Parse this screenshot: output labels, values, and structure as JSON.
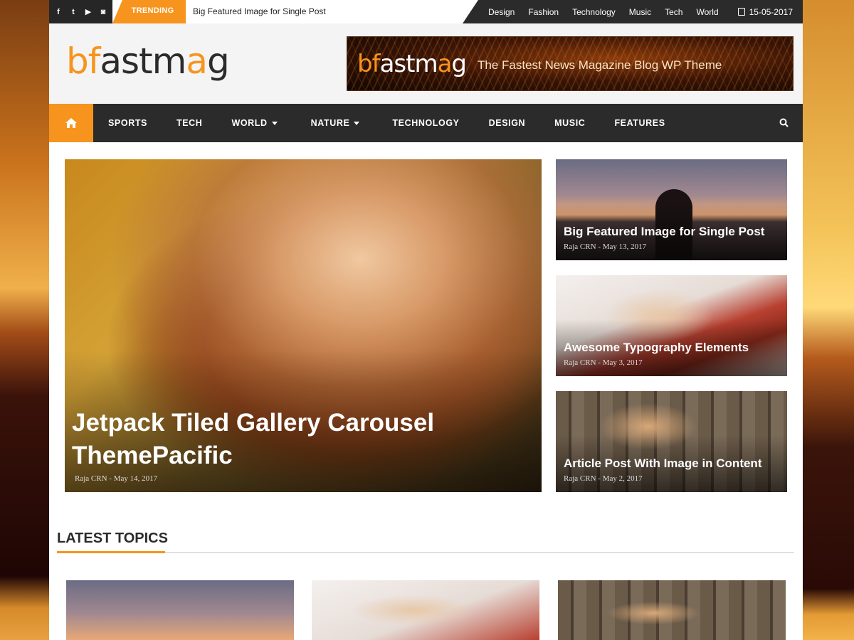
{
  "social": {
    "icons": [
      "facebook-icon",
      "twitter-icon",
      "youtube-icon",
      "instagram-icon"
    ],
    "glyphs": [
      "f",
      "t",
      "▶",
      "◙"
    ]
  },
  "trending": {
    "label": "TRENDING",
    "headline": "Big Featured Image for Single Post"
  },
  "top_nav": {
    "links": [
      "Design",
      "Fashion",
      "Technology",
      "Music",
      "Tech",
      "World"
    ],
    "date": "15-05-2017"
  },
  "logo": {
    "part1": "bf",
    "part2": "a",
    "part3": "stm",
    "part4": "a",
    "part5": "g"
  },
  "banner": {
    "logo_part1": "bf",
    "logo_part2": "a",
    "logo_part3": "stm",
    "logo_part4": "a",
    "logo_part5": "g",
    "tagline": "The Fastest News Magazine Blog WP Theme"
  },
  "main_nav": {
    "items": [
      {
        "label": "SPORTS",
        "dropdown": false
      },
      {
        "label": "TECH",
        "dropdown": false
      },
      {
        "label": "WORLD",
        "dropdown": true
      },
      {
        "label": "NATURE",
        "dropdown": true
      },
      {
        "label": "TECHNOLOGY",
        "dropdown": false
      },
      {
        "label": "DESIGN",
        "dropdown": false
      },
      {
        "label": "MUSIC",
        "dropdown": false
      },
      {
        "label": "FEATURES",
        "dropdown": false
      }
    ]
  },
  "featured": {
    "main": {
      "title": "Jetpack Tiled Gallery Carousel ThemePacific",
      "author": "Raja CRN",
      "date": "May 14, 2017"
    },
    "side": [
      {
        "title": "Big Featured Image for Single Post",
        "author": "Raja CRN",
        "date": "May 13, 2017"
      },
      {
        "title": "Awesome Typography Elements",
        "author": "Raja CRN",
        "date": "May 3, 2017"
      },
      {
        "title": "Article Post With Image in Content",
        "author": "Raja CRN",
        "date": "May 2, 2017"
      }
    ]
  },
  "latest": {
    "title": "LATEST TOPICS"
  },
  "colors": {
    "accent": "#f7941d",
    "dark": "#2b2b2b"
  }
}
